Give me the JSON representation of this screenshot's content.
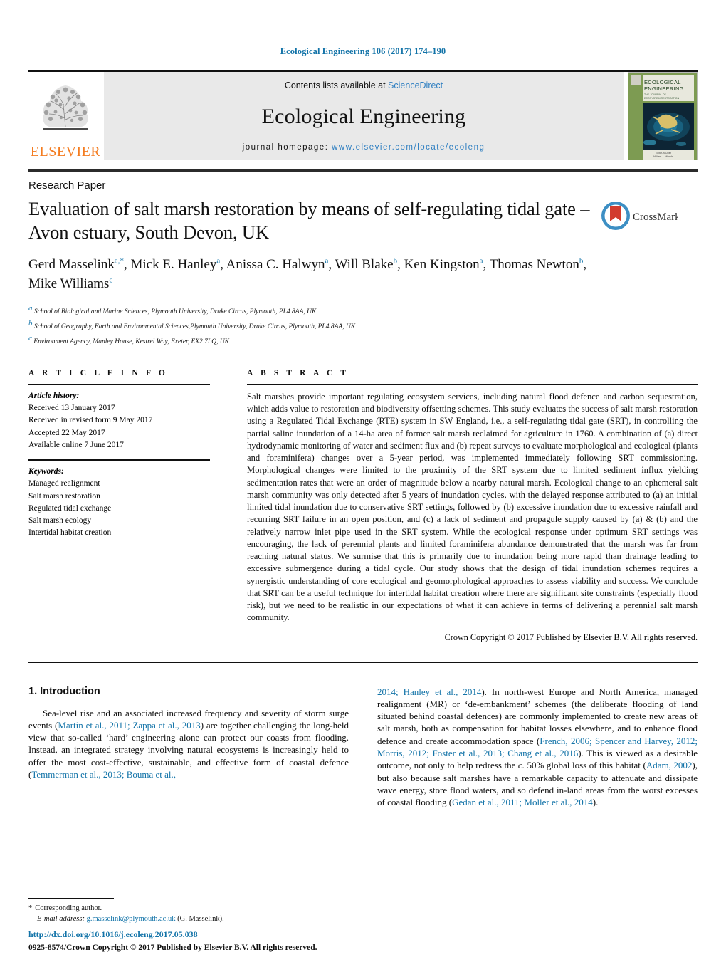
{
  "running_head": "Ecological Engineering 106 (2017) 174–190",
  "masthead": {
    "publisher_name": "ELSEVIER",
    "contents_prefix": "Contents lists available at ",
    "contents_link": "ScienceDirect",
    "journal_title": "Ecological Engineering",
    "homepage_prefix": "journal homepage: ",
    "homepage_url": "www.elsevier.com/locate/ecoleng",
    "cover": {
      "title_line1": "ECOLOGICAL",
      "title_line2": "ENGINEERING",
      "subtitle_line1": "THE JOURNAL OF",
      "subtitle_line2": "ECOSYSTEM RESTORATION",
      "footer_line1": "Editor-in-Chief",
      "footer_line2": "William J. Mitsch"
    }
  },
  "article": {
    "type": "Research Paper",
    "title": "Evaluation of salt marsh restoration by means of self-regulating tidal gate – Avon estuary, South Devon, UK",
    "crossmark_label": "CrossMark",
    "authors_html": "Gerd Masselink<sup>a,*</sup>, Mick E. Hanley<sup>a</sup>, Anissa C. Halwyn<sup>a</sup>, Will Blake<sup>b</sup>, Ken Kingston<sup>a</sup>, Thomas Newton<sup>b</sup>, Mike Williams<sup>c</sup>",
    "affiliations": [
      "a School of Biological and Marine Sciences, Plymouth University, Drake Circus, Plymouth, PL4 8AA, UK",
      "b School of Geography, Earth and Environmental Sciences,Plymouth University, Drake Circus, Plymouth, PL4 8AA, UK",
      "c Environment Agency, Manley House, Kestrel Way, Exeter, EX2 7LQ, UK"
    ]
  },
  "article_info": {
    "label": "A R T I C L E    I N F O",
    "history_head": "Article history:",
    "history": [
      "Received 13 January 2017",
      "Received in revised form 9 May 2017",
      "Accepted 22 May 2017",
      "Available online 7 June 2017"
    ],
    "keywords_head": "Keywords:",
    "keywords": [
      "Managed realignment",
      "Salt marsh restoration",
      "Regulated tidal exchange",
      "Salt marsh ecology",
      "Intertidal habitat creation"
    ]
  },
  "abstract": {
    "label": "A B S T R A C T",
    "text": "Salt marshes provide important regulating ecosystem services, including natural flood defence and carbon sequestration, which adds value to restoration and biodiversity offsetting schemes. This study evaluates the success of salt marsh restoration using a Regulated Tidal Exchange (RTE) system in SW England, i.e., a self-regulating tidal gate (SRT), in controlling the partial saline inundation of a 14-ha area of former salt marsh reclaimed for agriculture in 1760. A combination of (a) direct hydrodynamic monitoring of water and sediment flux and (b) repeat surveys to evaluate morphological and ecological (plants and foraminifera) changes over a 5-year period, was implemented immediately following SRT commissioning. Morphological changes were limited to the proximity of the SRT system due to limited sediment influx yielding sedimentation rates that were an order of magnitude below a nearby natural marsh. Ecological change to an ephemeral salt marsh community was only detected after 5 years of inundation cycles, with the delayed response attributed to (a) an initial limited tidal inundation due to conservative SRT settings, followed by (b) excessive inundation due to excessive rainfall and recurring SRT failure in an open position, and (c) a lack of sediment and propagule supply caused by (a) & (b) and the relatively narrow inlet pipe used in the SRT system. While the ecological response under optimum SRT settings was encouraging, the lack of perennial plants and limited foraminifera abundance demonstrated that the marsh was far from reaching natural status. We surmise that this is primarily due to inundation being more rapid than drainage leading to excessive submergence during a tidal cycle. Our study shows that the design of tidal inundation schemes requires a synergistic understanding of core ecological and geomorphological approaches to assess viability and success. We conclude that SRT can be a useful technique for intertidal habitat creation where there are significant site constraints (especially flood risk), but we need to be realistic in our expectations of what it can achieve in terms of delivering a perennial salt marsh community.",
    "copyright": "Crown Copyright © 2017 Published by Elsevier B.V. All rights reserved."
  },
  "introduction": {
    "heading": "1.  Introduction",
    "left_html": "Sea-level rise and an associated increased frequency and severity of storm surge events (<span class=\"ref\">Martin et al., 2011; Zappa et al., 2013</span>) are together challenging the long-held view that so-called ‘hard’ engineering alone can protect our coasts from flooding. Instead, an integrated strategy involving natural ecosystems is increasingly held to offer the most cost-effective, sustainable, and effective form of coastal defence (<span class=\"ref\">Temmerman et al., 2013; Bouma et al.,</span>",
    "right_html": "<span class=\"ref\">2014; Hanley et al., 2014</span>). In north-west Europe and North America, managed realignment (MR) or ‘de-embankment’ schemes (the deliberate flooding of land situated behind coastal defences) are commonly implemented to create new areas of salt marsh, both as compensation for habitat losses elsewhere, and to enhance flood defence and create accommodation space (<span class=\"ref\">French, 2006; Spencer and Harvey, 2012; Morris, 2012; Foster et al., 2013; Chang et al., 2016</span>). This is viewed as a desirable outcome, not only to help redress the <i>c.</i> 50% global loss of this habitat (<span class=\"ref\">Adam, 2002</span>), but also because salt marshes have a remarkable capacity to attenuate and dissipate wave energy, store flood waters, and so defend in-land areas from the worst excesses of coastal flooding (<span class=\"ref\">Gedan et al., 2011; Moller et al., 2014</span>)."
  },
  "footnote": {
    "corresponding_star": "*",
    "corresponding_text": "Corresponding author.",
    "email_label": "E-mail address:",
    "email": "g.masselink@plymouth.ac.uk",
    "email_suffix": "(G. Masselink)."
  },
  "doi": {
    "url": "http://dx.doi.org/10.1016/j.ecoleng.2017.05.038",
    "issn_line": "0925-8574/Crown Copyright © 2017 Published by Elsevier B.V. All rights reserved."
  },
  "colors": {
    "link_blue": "#1273a8",
    "sciencedirect_blue": "#2f7fc1",
    "elsevier_orange": "#f47c20",
    "crossmark_red": "#d23c2e",
    "crossmark_blue": "#3d8fc4"
  }
}
